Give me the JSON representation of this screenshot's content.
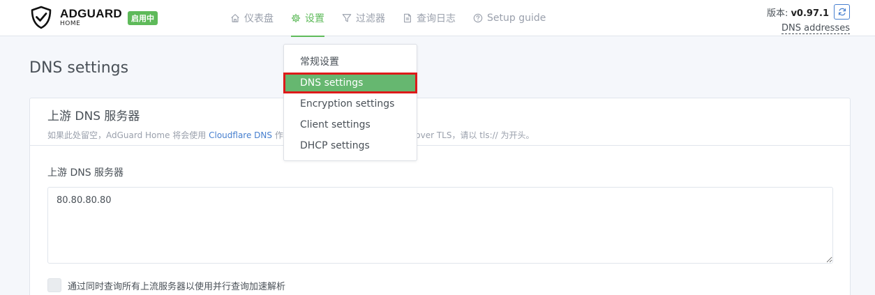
{
  "app": {
    "logo_text": "ADGUARD",
    "logo_sub": "HOME",
    "status_badge": "启用中"
  },
  "nav": {
    "items": [
      {
        "label": "仪表盘",
        "icon": "home-icon"
      },
      {
        "label": "设置",
        "icon": "gear-icon",
        "active": true
      },
      {
        "label": "过滤器",
        "icon": "filter-icon"
      },
      {
        "label": "查询日志",
        "icon": "document-icon"
      },
      {
        "label": "Setup guide",
        "icon": "help-circle-icon"
      }
    ]
  },
  "version": {
    "prefix": "版本: ",
    "value": "v0.97.1",
    "dns_addresses_link": "DNS addresses"
  },
  "settings_menu": {
    "items": [
      {
        "label": "常规设置"
      },
      {
        "label": "DNS settings",
        "selected": true
      },
      {
        "label": "Encryption settings"
      },
      {
        "label": "Client settings"
      },
      {
        "label": "DHCP settings"
      }
    ]
  },
  "page": {
    "title": "DNS settings"
  },
  "upstream_card": {
    "title": "上游 DNS 服务器",
    "subtitle_prefix": "如果此处留空，AdGuard Home 将会使用 ",
    "subtitle_link": "Cloudflare DNS",
    "subtitle_suffix": " 作为上游服务器。如需启用使用 DNS over TLS，请以 tls:// 为开头。",
    "field_label": "上游 DNS 服务器",
    "upstream_value": "80.80.80.80",
    "parallel_checkbox_label": "通过同时查询所有上流服务器以使用并行查询加速解析",
    "parallel_checked": false
  },
  "colors": {
    "accent_green": "#5eba5a",
    "selected_item_bg": "#66b770",
    "highlight_border": "#dd1a1a",
    "link_blue": "#467fcf"
  }
}
